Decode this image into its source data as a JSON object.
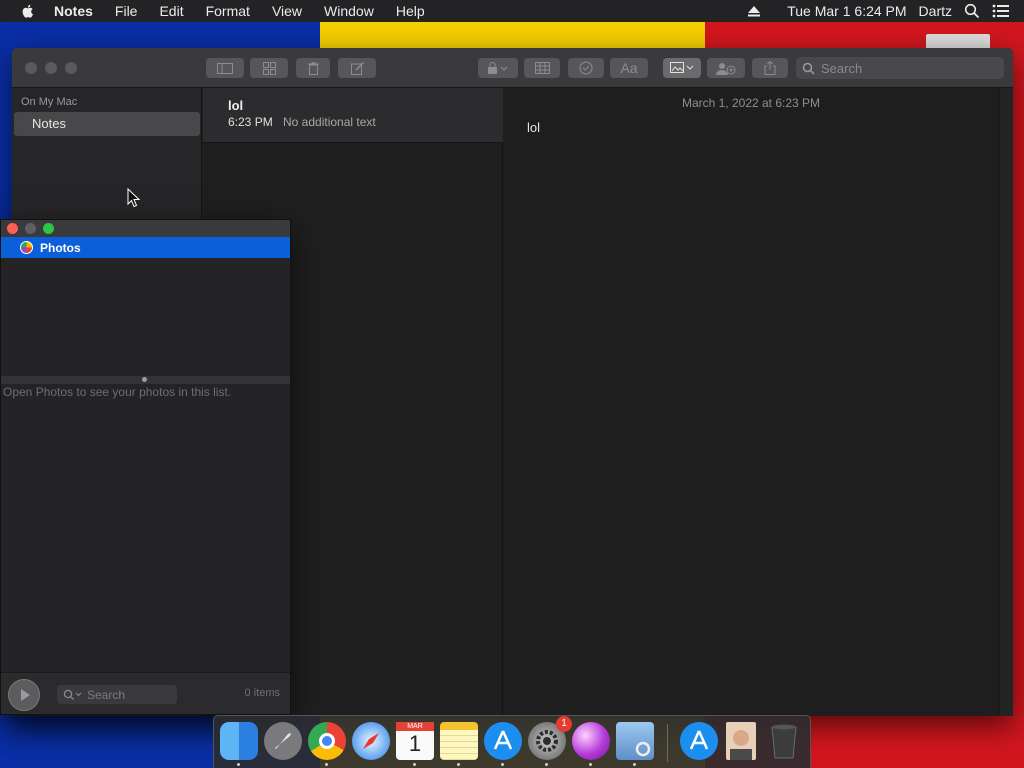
{
  "menubar": {
    "app_name": "Notes",
    "items": [
      "File",
      "Edit",
      "Format",
      "View",
      "Window",
      "Help"
    ],
    "datetime": "Tue Mar 1  6:24 PM",
    "user": "Dartz"
  },
  "notes_window": {
    "search_placeholder": "Search",
    "sidebar": {
      "section_label": "On My Mac",
      "folder": "Notes"
    },
    "note_list": [
      {
        "title": "lol",
        "time": "6:23 PM",
        "preview": "No additional text"
      }
    ],
    "editor": {
      "date": "March 1, 2022 at 6:23 PM",
      "body": "lol"
    }
  },
  "photos_panel": {
    "source": "Photos",
    "empty_message": "Open Photos to see your photos in this list.",
    "search_placeholder": "Search",
    "count": "0 items"
  },
  "dock": {
    "apps": [
      "finder",
      "launchpad",
      "chrome",
      "safari",
      "calendar",
      "notes",
      "app-store",
      "system-preferences",
      "color-ui",
      "preview",
      "app-store-downloads",
      "contact-photo",
      "trash"
    ],
    "calendar": {
      "month": "MAR",
      "day": "1"
    },
    "system_preferences_badge": "1"
  },
  "colors": {
    "selection": "#0b5fd8",
    "wallpaper_blue": "#0a2fa6",
    "wallpaper_yellow": "#f5cf00",
    "wallpaper_red": "#d2161e"
  }
}
